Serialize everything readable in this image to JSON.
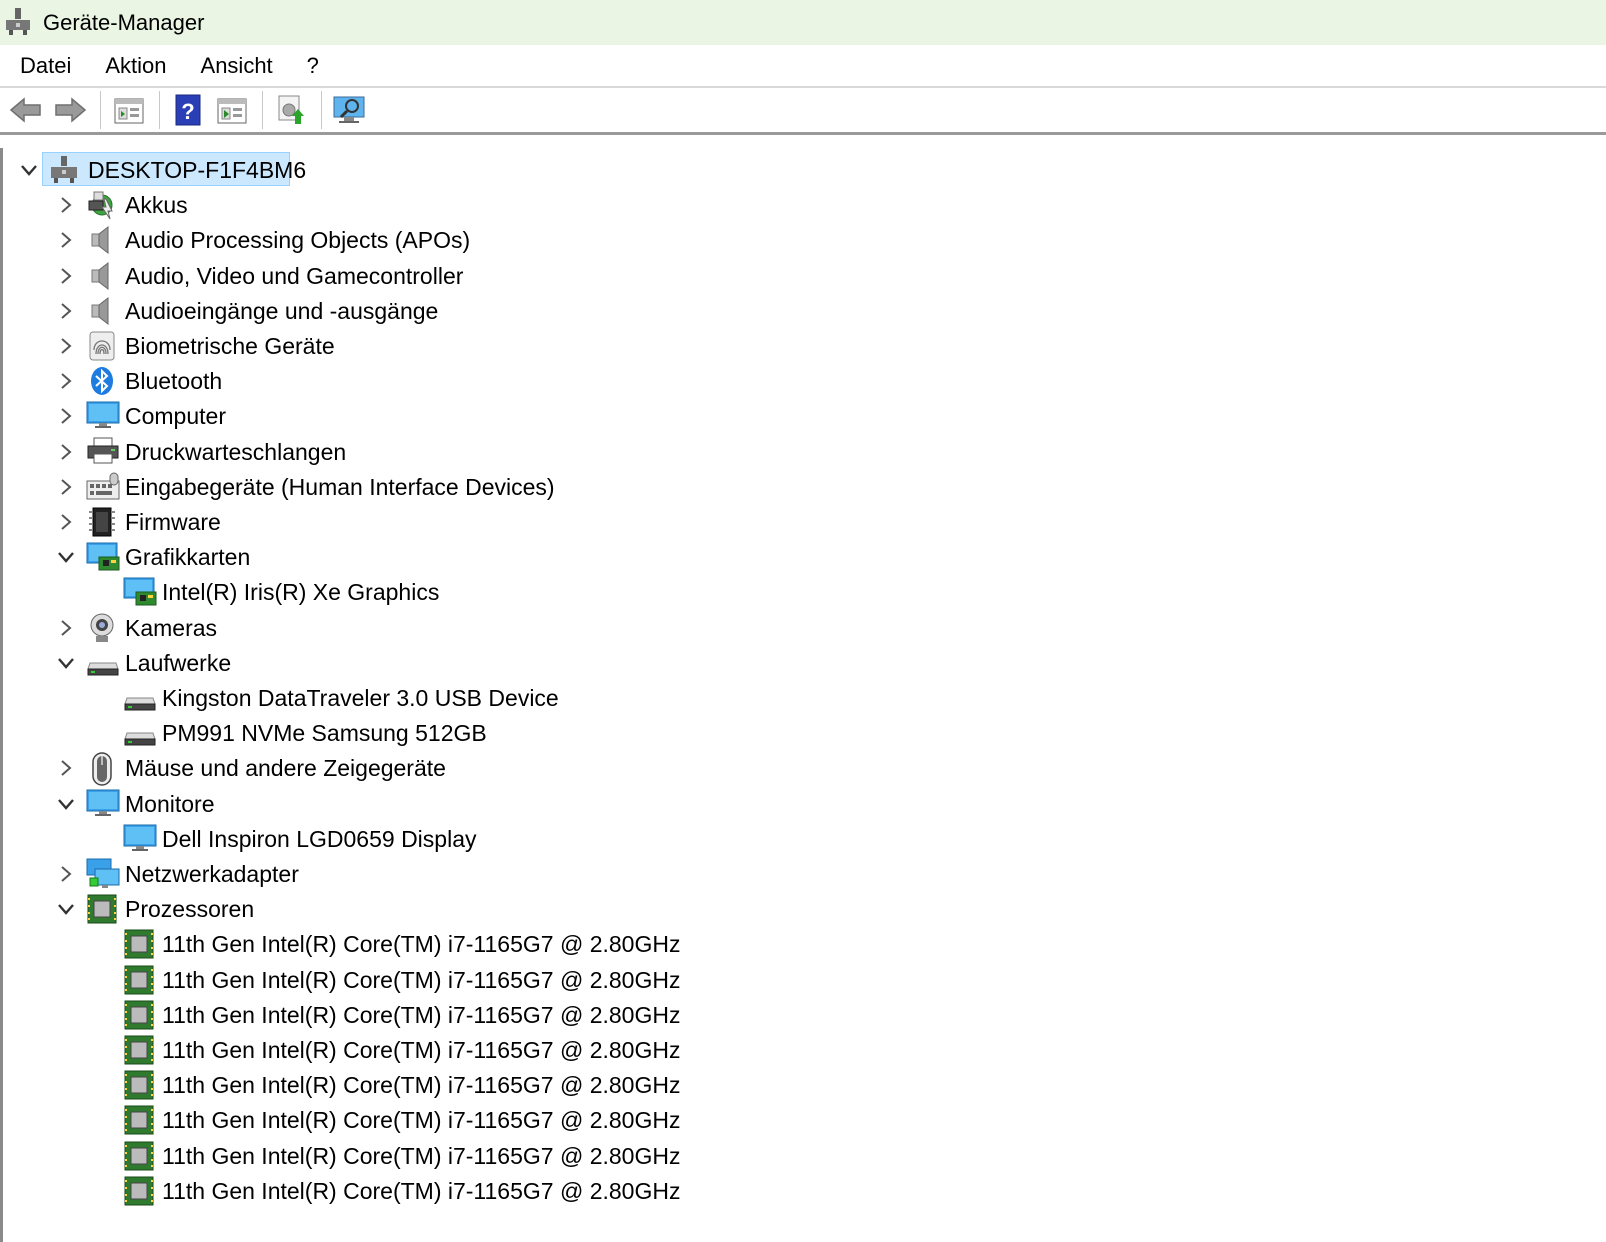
{
  "window": {
    "title": "Geräte-Manager"
  },
  "menu": [
    "Datei",
    "Aktion",
    "Ansicht",
    "?"
  ],
  "toolbar": {
    "buttons": [
      "back-arrow-icon",
      "forward-arrow-icon",
      "properties-icon",
      "help-icon",
      "run-icon",
      "update-driver-icon",
      "scan-hardware-icon"
    ]
  },
  "tree": {
    "root": "DESKTOP-F1F4BM6",
    "categories": [
      {
        "label": "Akkus",
        "icon": "battery-icon",
        "expanded": false
      },
      {
        "label": "Audio Processing Objects (APOs)",
        "icon": "speaker-icon",
        "expanded": false
      },
      {
        "label": "Audio, Video und Gamecontroller",
        "icon": "speaker-icon",
        "expanded": false
      },
      {
        "label": "Audioeingänge und -ausgänge",
        "icon": "speaker-icon",
        "expanded": false
      },
      {
        "label": "Biometrische Geräte",
        "icon": "fingerprint-icon",
        "expanded": false
      },
      {
        "label": "Bluetooth",
        "icon": "bluetooth-icon",
        "expanded": false
      },
      {
        "label": "Computer",
        "icon": "monitor-icon",
        "expanded": false
      },
      {
        "label": "Druckwarteschlangen",
        "icon": "printer-icon",
        "expanded": false
      },
      {
        "label": "Eingabegeräte (Human Interface Devices)",
        "icon": "keyboard-icon",
        "expanded": false
      },
      {
        "label": "Firmware",
        "icon": "chip-icon",
        "expanded": false
      },
      {
        "label": "Grafikkarten",
        "icon": "display-adapter-icon",
        "expanded": true,
        "children": [
          "Intel(R) Iris(R) Xe Graphics"
        ]
      },
      {
        "label": "Kameras",
        "icon": "webcam-icon",
        "expanded": false
      },
      {
        "label": "Laufwerke",
        "icon": "drive-icon",
        "expanded": true,
        "children": [
          "Kingston DataTraveler 3.0 USB Device",
          "PM991 NVMe Samsung 512GB"
        ]
      },
      {
        "label": "Mäuse und andere Zeigegeräte",
        "icon": "mouse-icon",
        "expanded": false
      },
      {
        "label": "Monitore",
        "icon": "monitor-icon",
        "expanded": true,
        "children": [
          "Dell Inspiron LGD0659 Display"
        ]
      },
      {
        "label": "Netzwerkadapter",
        "icon": "network-icon",
        "expanded": false
      },
      {
        "label": "Prozessoren",
        "icon": "processor-icon",
        "expanded": true,
        "children": [
          "11th Gen Intel(R) Core(TM) i7-1165G7 @ 2.80GHz",
          "11th Gen Intel(R) Core(TM) i7-1165G7 @ 2.80GHz",
          "11th Gen Intel(R) Core(TM) i7-1165G7 @ 2.80GHz",
          "11th Gen Intel(R) Core(TM) i7-1165G7 @ 2.80GHz",
          "11th Gen Intel(R) Core(TM) i7-1165G7 @ 2.80GHz",
          "11th Gen Intel(R) Core(TM) i7-1165G7 @ 2.80GHz",
          "11th Gen Intel(R) Core(TM) i7-1165G7 @ 2.80GHz",
          "11th Gen Intel(R) Core(TM) i7-1165G7 @ 2.80GHz"
        ]
      }
    ]
  }
}
